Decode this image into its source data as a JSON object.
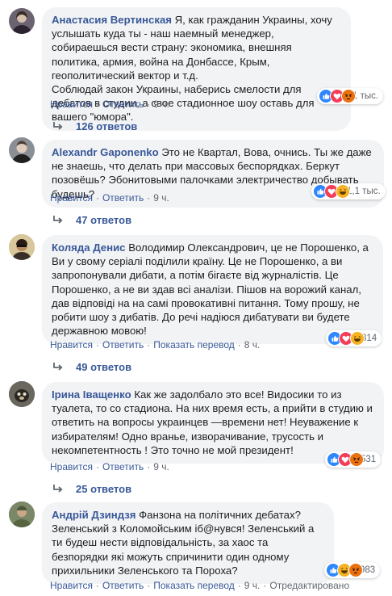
{
  "comments": [
    {
      "author": "Анастасия Вертинская",
      "text": "Я, как гражданин Украины, хочу услышать куда ты - наш наемный менеджер, собираешься вести страну: экономика, внешняя политика, армия, война на Донбассе, Крым, геополитический вектор и т.д.\nСоблюдай закон Украины, наберись смелости для дебатов в студии, а свое стадионное шоу оставь для вашего \"юмора\".",
      "reaction_icons": [
        "like",
        "love",
        "angry"
      ],
      "reaction_count": "1 тыс.",
      "like_label": "Нравится",
      "reply_label": "Ответить",
      "time": "9 ч.",
      "replies_label": "126 ответов"
    },
    {
      "author": "Alexandr Gaponenko",
      "text": "Это не Квартал, Вова, очнись. Ты же даже не знаешь, что делать при массовых беспорядках. Беркут позовёшь? Эбонитовыми палочками электричество добывать будешь?",
      "reaction_icons": [
        "like",
        "love",
        "haha"
      ],
      "reaction_count": "1,1 тыс.",
      "like_label": "Нравится",
      "reply_label": "Ответить",
      "time": "9 ч.",
      "replies_label": "47 ответов"
    },
    {
      "author": "Коляда Денис",
      "text": "Володимир Олександрович, це не Порошенко, а Ви у свому серіалі поділили країну. Це не Порошенко, а ви запропонували дибати, а потім бігаєте від журналістів. Це Порошенко, а не ви здав всі аналізи. Пішов на ворожий канал, дав відповіді на на самі провокативні питання. Тому прошу, не робити шоу з дибатів. До речі надіюся дибатувати ви будете державною мовою!",
      "reaction_icons": [
        "like",
        "love",
        "haha"
      ],
      "reaction_count": "814",
      "like_label": "Нравится",
      "reply_label": "Ответить",
      "translate_label": "Показать перевод",
      "time": "8 ч.",
      "replies_label": "49 ответов"
    },
    {
      "author": "Ірина Іващенко",
      "text": "Как же задолбало это все! Видосики то из туалета, то со стадиона. На них время есть, а прийти в студию и ответить на вопросы украинцев —времени нет! Неуважение к избирателям! Одно вранье, изворачивание, трусость и некомпетентность ! Это точно не мой президент!",
      "reaction_icons": [
        "like",
        "love",
        "angry"
      ],
      "reaction_count": "531",
      "like_label": "Нравится",
      "reply_label": "Ответить",
      "time": "9 ч.",
      "replies_label": "25 ответов"
    },
    {
      "author": "Андрій Дзиндзя",
      "text": "Фанзона на політичних дебатах? Зеленський з Коломойським іб@нувся! Зеленський а ти будеш нести відповідальність, за хаос та безпорядки які можуть спричинити один одному прихильники Зеленського та Пороха?",
      "reaction_icons": [
        "like",
        "haha",
        "angry"
      ],
      "reaction_count": "983",
      "like_label": "Нравится",
      "reply_label": "Ответить",
      "translate_label": "Показать перевод",
      "time": "9 ч.",
      "edited_label": "Отредактировано"
    }
  ],
  "colors": {
    "link": "#385898",
    "bubble": "#f2f3f5",
    "meta": "#606770",
    "like": "#2d88ff",
    "love": "#f33e58",
    "haha": "#f7b125",
    "angry": "#e9710f"
  }
}
